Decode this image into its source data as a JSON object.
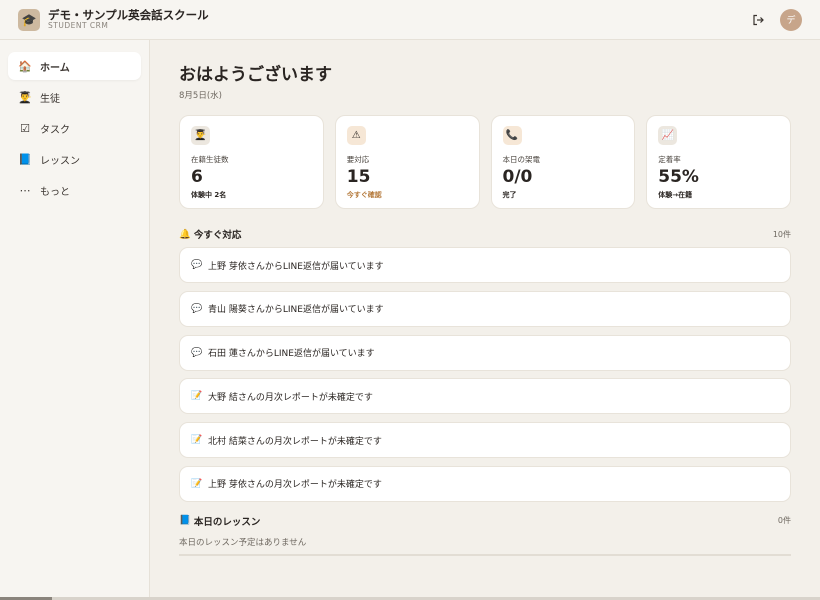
{
  "header": {
    "brand_name": "デモ・サンプル英会話スクール",
    "brand_sub": "STUDENT CRM",
    "logo_icon": "🎓",
    "logout_icon": "logout-icon",
    "avatar_text": "デ"
  },
  "sidebar": {
    "items": [
      {
        "label": "ホーム",
        "icon": "🏠"
      },
      {
        "label": "生徒",
        "icon": "👨‍🎓"
      },
      {
        "label": "タスク",
        "icon": "☑"
      },
      {
        "label": "レッスン",
        "icon": "📘"
      },
      {
        "label": "もっと",
        "icon": "⋯"
      }
    ]
  },
  "main": {
    "greeting": "おはようございます",
    "date": "8月5日(水)",
    "stats": [
      {
        "icon": "👨‍🎓",
        "label": "在籍生徒数",
        "value": "6",
        "sub": "体験中 2名"
      },
      {
        "icon": "⚠",
        "label": "要対応",
        "value": "15",
        "sub": "今すぐ確認"
      },
      {
        "icon": "📞",
        "label": "本日の架電",
        "value": "0/0",
        "sub": "完了"
      },
      {
        "icon": "📈",
        "label": "定着率",
        "value": "55%",
        "sub": "体験→在籍"
      }
    ],
    "urgent": {
      "icon": "🔔",
      "title": "今すぐ対応",
      "count": "10件",
      "items": [
        {
          "icon": "💬",
          "text": "上野 芽依さんからLINE返信が届いています"
        },
        {
          "icon": "💬",
          "text": "青山 陽葵さんからLINE返信が届いています"
        },
        {
          "icon": "💬",
          "text": "石田 蓮さんからLINE返信が届いています"
        },
        {
          "icon": "📝",
          "text": "大野 結さんの月次レポートが未確定です"
        },
        {
          "icon": "📝",
          "text": "北村 結菜さんの月次レポートが未確定です"
        },
        {
          "icon": "📝",
          "text": "上野 芽依さんの月次レポートが未確定です"
        }
      ]
    },
    "lessons": {
      "icon": "📘",
      "title": "本日のレッスン",
      "count": "0件",
      "empty": "本日のレッスン予定はありません"
    }
  },
  "colors": {
    "background": "#f3f0ea",
    "card": "#ffffff",
    "accent": "#c7a58a",
    "warn": "#b57a3c"
  }
}
